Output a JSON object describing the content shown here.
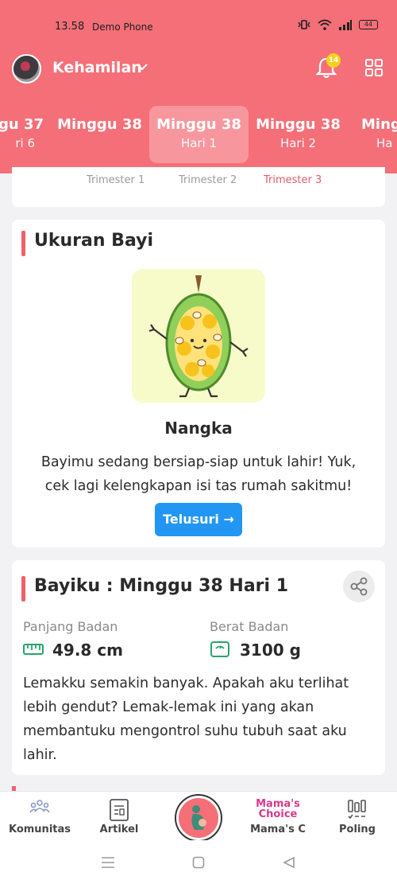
{
  "status_bar": {
    "time": "13.58",
    "device_name": "Demo Phone",
    "battery": "44"
  },
  "header": {
    "title": "Kehamilan",
    "notification_count": "14",
    "colors": {
      "brand": "#f46f78",
      "badge": "#f5d21d"
    }
  },
  "weeks": [
    {
      "week": "gu 37",
      "day": "ri 6"
    },
    {
      "week": "Minggu 38",
      "day": ""
    },
    {
      "week": "Minggu 38",
      "day": "Hari 1"
    },
    {
      "week": "Minggu 38",
      "day": "Hari 2"
    },
    {
      "week": "Ming",
      "day": "Ha"
    }
  ],
  "trimesters": [
    "Trimester 1",
    "Trimester 2",
    "Trimester 3"
  ],
  "baby_size": {
    "title": "Ukuran Bayi",
    "fruit": "Nangka",
    "description": "Bayimu sedang bersiap-siap untuk lahir! Yuk, cek lagi kelengkapan isi tas rumah sakitmu!",
    "button": "Telusuri →"
  },
  "baby_info": {
    "title": "Bayiku : Minggu 38 Hari 1",
    "length_label": "Panjang Badan",
    "length_value": "49.8 cm",
    "weight_label": "Berat Badan",
    "weight_value": "3100 g",
    "description": "Lemakku semakin banyak. Apakah aku terlihat lebih gendut? Lemak-lemak ini yang akan membantuku mengontrol suhu tubuh saat aku lahir."
  },
  "bottom_nav": {
    "komunitas": "Komunitas",
    "artikel": "Artikel",
    "mamas_logo": "Mama's Choice",
    "mamas": "Mama's C",
    "poling": "Poling"
  }
}
